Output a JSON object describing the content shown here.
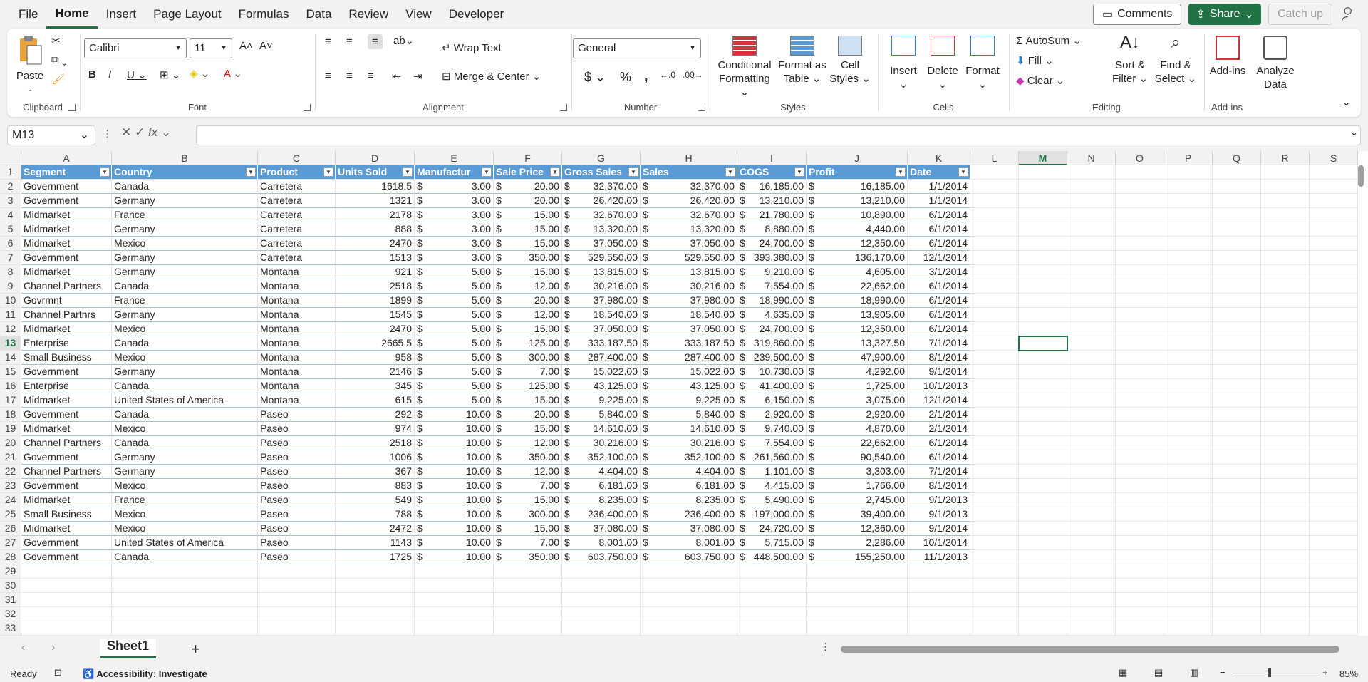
{
  "menu": {
    "tabs": [
      "File",
      "Home",
      "Insert",
      "Page Layout",
      "Formulas",
      "Data",
      "Review",
      "View",
      "Developer"
    ],
    "active": "Home",
    "comments_label": "Comments",
    "share_label": "Share",
    "catchup_label": "Catch up"
  },
  "ribbon": {
    "clipboard": {
      "label": "Clipboard",
      "paste": "Paste"
    },
    "font": {
      "label": "Font",
      "family": "Calibri",
      "size": "11"
    },
    "alignment": {
      "label": "Alignment",
      "wrap": "Wrap Text",
      "merge": "Merge & Center"
    },
    "number": {
      "label": "Number",
      "format": "General"
    },
    "styles": {
      "label": "Styles",
      "conditional": "Conditional Formatting",
      "format_table": "Format as Table",
      "cell_styles": "Cell Styles"
    },
    "cells": {
      "label": "Cells",
      "insert": "Insert",
      "delete": "Delete",
      "format": "Format"
    },
    "editing": {
      "label": "Editing",
      "autosum": "AutoSum",
      "fill": "Fill",
      "clear": "Clear",
      "sort": "Sort & Filter",
      "find": "Find & Select"
    },
    "addins": {
      "label": "Add-ins",
      "addins": "Add-ins",
      "analyze": "Analyze Data"
    }
  },
  "formula_bar": {
    "namebox": "M13",
    "formula": ""
  },
  "columns": [
    "A",
    "B",
    "C",
    "D",
    "E",
    "F",
    "G",
    "H",
    "I",
    "J",
    "K",
    "L",
    "M",
    "N",
    "O",
    "P",
    "Q",
    "R",
    "S"
  ],
  "selected_column": "M",
  "selected_row": 13,
  "table_headers": [
    "Segment",
    "Country",
    "Product",
    "Units Sold",
    "Manufactur",
    "Sale Price",
    "Gross Sales",
    "Sales",
    "COGS",
    "Profit",
    "Date"
  ],
  "rows": [
    [
      "Government",
      "Canada",
      "Carretera",
      "1618.5",
      "3.00",
      "20.00",
      "32,370.00",
      "32,370.00",
      "16,185.00",
      "16,185.00",
      "1/1/2014"
    ],
    [
      "Government",
      "Germany",
      "Carretera",
      "1321",
      "3.00",
      "20.00",
      "26,420.00",
      "26,420.00",
      "13,210.00",
      "13,210.00",
      "1/1/2014"
    ],
    [
      "Midmarket",
      "France",
      "Carretera",
      "2178",
      "3.00",
      "15.00",
      "32,670.00",
      "32,670.00",
      "21,780.00",
      "10,890.00",
      "6/1/2014"
    ],
    [
      "Midmarket",
      "Germany",
      "Carretera",
      "888",
      "3.00",
      "15.00",
      "13,320.00",
      "13,320.00",
      "8,880.00",
      "4,440.00",
      "6/1/2014"
    ],
    [
      "Midmarket",
      "Mexico",
      "Carretera",
      "2470",
      "3.00",
      "15.00",
      "37,050.00",
      "37,050.00",
      "24,700.00",
      "12,350.00",
      "6/1/2014"
    ],
    [
      "Government",
      "Germany",
      "Carretera",
      "1513",
      "3.00",
      "350.00",
      "529,550.00",
      "529,550.00",
      "393,380.00",
      "136,170.00",
      "12/1/2014"
    ],
    [
      "Midmarket",
      "Germany",
      "Montana",
      "921",
      "5.00",
      "15.00",
      "13,815.00",
      "13,815.00",
      "9,210.00",
      "4,605.00",
      "3/1/2014"
    ],
    [
      "Channel Partners",
      "Canada",
      "Montana",
      "2518",
      "5.00",
      "12.00",
      "30,216.00",
      "30,216.00",
      "7,554.00",
      "22,662.00",
      "6/1/2014"
    ],
    [
      "Govrmnt",
      "France",
      "Montana",
      "1899",
      "5.00",
      "20.00",
      "37,980.00",
      "37,980.00",
      "18,990.00",
      "18,990.00",
      "6/1/2014"
    ],
    [
      "Channel Partnrs",
      "Germany",
      "Montana",
      "1545",
      "5.00",
      "12.00",
      "18,540.00",
      "18,540.00",
      "4,635.00",
      "13,905.00",
      "6/1/2014"
    ],
    [
      "Midmarket",
      "Mexico",
      "Montana",
      "2470",
      "5.00",
      "15.00",
      "37,050.00",
      "37,050.00",
      "24,700.00",
      "12,350.00",
      "6/1/2014"
    ],
    [
      "Enterprise",
      "Canada",
      "Montana",
      "2665.5",
      "5.00",
      "125.00",
      "333,187.50",
      "333,187.50",
      "319,860.00",
      "13,327.50",
      "7/1/2014"
    ],
    [
      "Small Business",
      "Mexico",
      "Montana",
      "958",
      "5.00",
      "300.00",
      "287,400.00",
      "287,400.00",
      "239,500.00",
      "47,900.00",
      "8/1/2014"
    ],
    [
      "Government",
      "Germany",
      "Montana",
      "2146",
      "5.00",
      "7.00",
      "15,022.00",
      "15,022.00",
      "10,730.00",
      "4,292.00",
      "9/1/2014"
    ],
    [
      "Enterprise",
      "Canada",
      "Montana",
      "345",
      "5.00",
      "125.00",
      "43,125.00",
      "43,125.00",
      "41,400.00",
      "1,725.00",
      "10/1/2013"
    ],
    [
      "Midmarket",
      "United States of America",
      "Montana",
      "615",
      "5.00",
      "15.00",
      "9,225.00",
      "9,225.00",
      "6,150.00",
      "3,075.00",
      "12/1/2014"
    ],
    [
      "Government",
      "Canada",
      "Paseo",
      "292",
      "10.00",
      "20.00",
      "5,840.00",
      "5,840.00",
      "2,920.00",
      "2,920.00",
      "2/1/2014"
    ],
    [
      "Midmarket",
      "Mexico",
      "Paseo",
      "974",
      "10.00",
      "15.00",
      "14,610.00",
      "14,610.00",
      "9,740.00",
      "4,870.00",
      "2/1/2014"
    ],
    [
      "Channel Partners",
      "Canada",
      "Paseo",
      "2518",
      "10.00",
      "12.00",
      "30,216.00",
      "30,216.00",
      "7,554.00",
      "22,662.00",
      "6/1/2014"
    ],
    [
      "Government",
      "Germany",
      "Paseo",
      "1006",
      "10.00",
      "350.00",
      "352,100.00",
      "352,100.00",
      "261,560.00",
      "90,540.00",
      "6/1/2014"
    ],
    [
      "Channel Partners",
      "Germany",
      "Paseo",
      "367",
      "10.00",
      "12.00",
      "4,404.00",
      "4,404.00",
      "1,101.00",
      "3,303.00",
      "7/1/2014"
    ],
    [
      "Government",
      "Mexico",
      "Paseo",
      "883",
      "10.00",
      "7.00",
      "6,181.00",
      "6,181.00",
      "4,415.00",
      "1,766.00",
      "8/1/2014"
    ],
    [
      "Midmarket",
      "France",
      "Paseo",
      "549",
      "10.00",
      "15.00",
      "8,235.00",
      "8,235.00",
      "5,490.00",
      "2,745.00",
      "9/1/2013"
    ],
    [
      "Small Business",
      "Mexico",
      "Paseo",
      "788",
      "10.00",
      "300.00",
      "236,400.00",
      "236,400.00",
      "197,000.00",
      "39,400.00",
      "9/1/2013"
    ],
    [
      "Midmarket",
      "Mexico",
      "Paseo",
      "2472",
      "10.00",
      "15.00",
      "37,080.00",
      "37,080.00",
      "24,720.00",
      "12,360.00",
      "9/1/2014"
    ],
    [
      "Government",
      "United States of America",
      "Paseo",
      "1143",
      "10.00",
      "7.00",
      "8,001.00",
      "8,001.00",
      "5,715.00",
      "2,286.00",
      "10/1/2014"
    ],
    [
      "Government",
      "Canada",
      "Paseo",
      "1725",
      "10.00",
      "350.00",
      "603,750.00",
      "603,750.00",
      "448,500.00",
      "155,250.00",
      "11/1/2013"
    ]
  ],
  "currency_symbol": "$",
  "sheet_tab": "Sheet1",
  "status": {
    "ready": "Ready",
    "accessibility": "Accessibility: Investigate",
    "zoom": "85%"
  },
  "colors": {
    "accent": "#217346",
    "table_header": "#5b9bd5"
  }
}
